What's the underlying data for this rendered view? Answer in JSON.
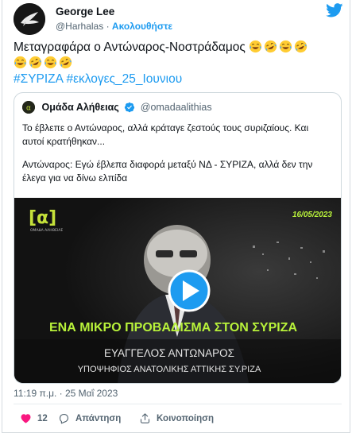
{
  "author": {
    "name": "George Lee",
    "handle": "@Harhalas",
    "separator": "·",
    "follow_label": "Ακολουθήστε"
  },
  "tweet": {
    "text_line1": "Μεταγραφάρα ο Αντώναρος-Νοστράδαμος",
    "hashtags": [
      "#ΣΥΡΙΖΑ",
      "#εκλογες_25_Ιουνιου"
    ],
    "emoji_line1": [
      "laughing-crying",
      "rofl",
      "laughing-crying",
      "rofl"
    ],
    "emoji_line2": [
      "laughing-crying",
      "rofl",
      "laughing-crying",
      "rofl"
    ]
  },
  "quoted": {
    "name": "Ομάδα Αλήθειας",
    "handle": "@omadaalithias",
    "paragraph1_line1": "Το έβλεπε ο Αντώναρος, αλλά κράταγε ζεστούς τους συριζαίους. Και",
    "paragraph1_line2": "αυτοί κρατήθηκαν...",
    "paragraph2_line1": "Αντώναρος: Εγώ έβλεπα διαφορά μεταξύ ΝΔ - ΣΥΡΙΖΑ, αλλά δεν την",
    "paragraph2_line2": "έλεγα για να δίνω ελπίδα",
    "video": {
      "logo_text": "[α]",
      "logo_sub": "ΟΜΑΔΑ ΑΛΗΘΕΙΑΣ",
      "date": "16/05/2023",
      "caption": "ΕΝΑ ΜΙΚΡΟ ΠΡΟΒΑΔΙΣΜΑ ΣΤΟΝ ΣΥΡΙΖΑ",
      "lower_name": "ΕΥΑΓΓΕΛΟΣ ΑΝΤΩΝΑΡΟΣ",
      "lower_role": "ΥΠΟΨΗΦΙΟΣ ΑΝΑΤΟΛΙΚΗΣ ΑΤΤΙΚΗΣ ΣΥ.ΡΙΖΑ"
    }
  },
  "timestamp": "11:19 π.μ. · 25 Μαΐ 2023",
  "actions": {
    "like_count": "12",
    "reply_label": "Απάντηση",
    "share_label": "Κοινοποίηση"
  },
  "colors": {
    "accent": "#1d9bf0",
    "like": "#f91880",
    "video_caption": "#b8f23a",
    "video_date": "#b8f23a"
  }
}
